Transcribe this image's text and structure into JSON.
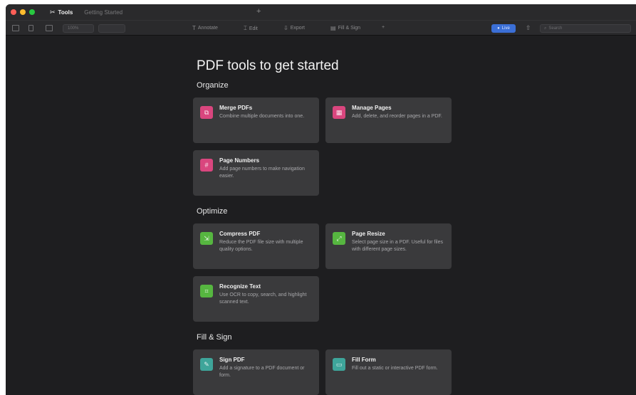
{
  "tabs": [
    {
      "label": "Tools",
      "icon": "tools-icon"
    },
    {
      "label": "Getting Started"
    }
  ],
  "new_tab": "+",
  "toolbar": {
    "zoom": "100%",
    "annotate": "Annotate",
    "edit": "Edit",
    "export": "Export",
    "fill_sign": "Fill & Sign",
    "more": "+",
    "live": "Live",
    "search_placeholder": "Search"
  },
  "title": "PDF tools to get started",
  "sections": {
    "organize": "Organize",
    "optimize": "Optimize",
    "fill_sign": "Fill & Sign"
  },
  "cards": {
    "merge": {
      "title": "Merge PDFs",
      "desc": "Combine multiple documents into one.",
      "icon": "merge-icon"
    },
    "manage": {
      "title": "Manage Pages",
      "desc": "Add, delete, and reorder pages in a PDF.",
      "icon": "pages-icon"
    },
    "numbers": {
      "title": "Page Numbers",
      "desc": "Add page numbers to make navigation easier.",
      "icon": "page-number-icon"
    },
    "compress": {
      "title": "Compress PDF",
      "desc": "Reduce the PDF file size with multiple quality options.",
      "icon": "compress-icon"
    },
    "resize": {
      "title": "Page Resize",
      "desc": "Select page size in a PDF. Useful for files with different page sizes.",
      "icon": "resize-icon"
    },
    "recognize": {
      "title": "Recognize Text",
      "desc": "Use OCR to copy, search, and highlight scanned text.",
      "icon": "ocr-icon"
    },
    "sign": {
      "title": "Sign PDF",
      "desc": "Add a signature to a PDF document or form.",
      "icon": "signature-icon"
    },
    "fillform": {
      "title": "Fill Form",
      "desc": "Fill out a static or interactive PDF form.",
      "icon": "form-icon"
    }
  },
  "colors": {
    "organize_accent": "#d9467e",
    "optimize_accent": "#56b640",
    "fill_sign_accent": "#3ea59a",
    "live_button": "#3b6fd6"
  }
}
